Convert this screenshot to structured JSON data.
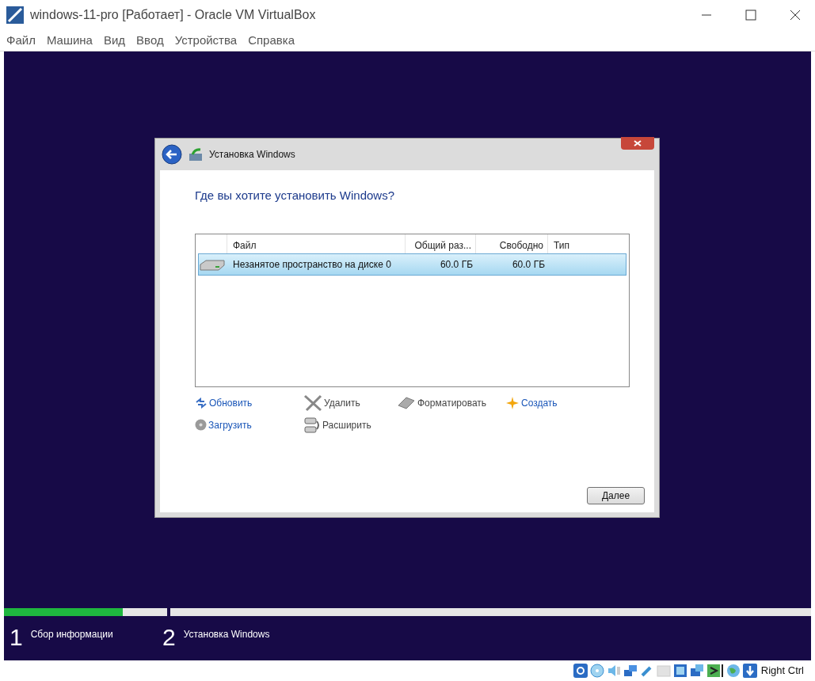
{
  "window": {
    "title": "windows-11-pro [Работает] - Oracle VM VirtualBox"
  },
  "menu": [
    "Файл",
    "Машина",
    "Вид",
    "Ввод",
    "Устройства",
    "Справка"
  ],
  "dialog": {
    "title": "Установка Windows",
    "heading": "Где вы хотите установить Windows?",
    "table": {
      "columns": [
        "Файл",
        "Общий раз...",
        "Свободно",
        "Тип"
      ],
      "rows": [
        {
          "name": "Незанятое пространство на диске 0",
          "total": "60.0 ГБ",
          "free": "60.0 ГБ",
          "selected": true
        }
      ]
    },
    "actions": [
      {
        "label": "Обновить",
        "kind": "refresh",
        "enabled": true
      },
      {
        "label": "Удалить",
        "kind": "delete",
        "enabled": false
      },
      {
        "label": "Форматировать",
        "kind": "format",
        "enabled": false
      },
      {
        "label": "Создать",
        "kind": "create",
        "enabled": true
      },
      {
        "label": "Загрузить",
        "kind": "load",
        "enabled": true
      },
      {
        "label": "Расширить",
        "kind": "extend",
        "enabled": false
      }
    ],
    "next_button": "Далее"
  },
  "steps": [
    {
      "number": "1",
      "label": "Сбор информации",
      "level": 0.73
    },
    {
      "number": "2",
      "label": "Установка Windows"
    }
  ],
  "status_bar": {
    "host_key": "Right Ctrl"
  }
}
